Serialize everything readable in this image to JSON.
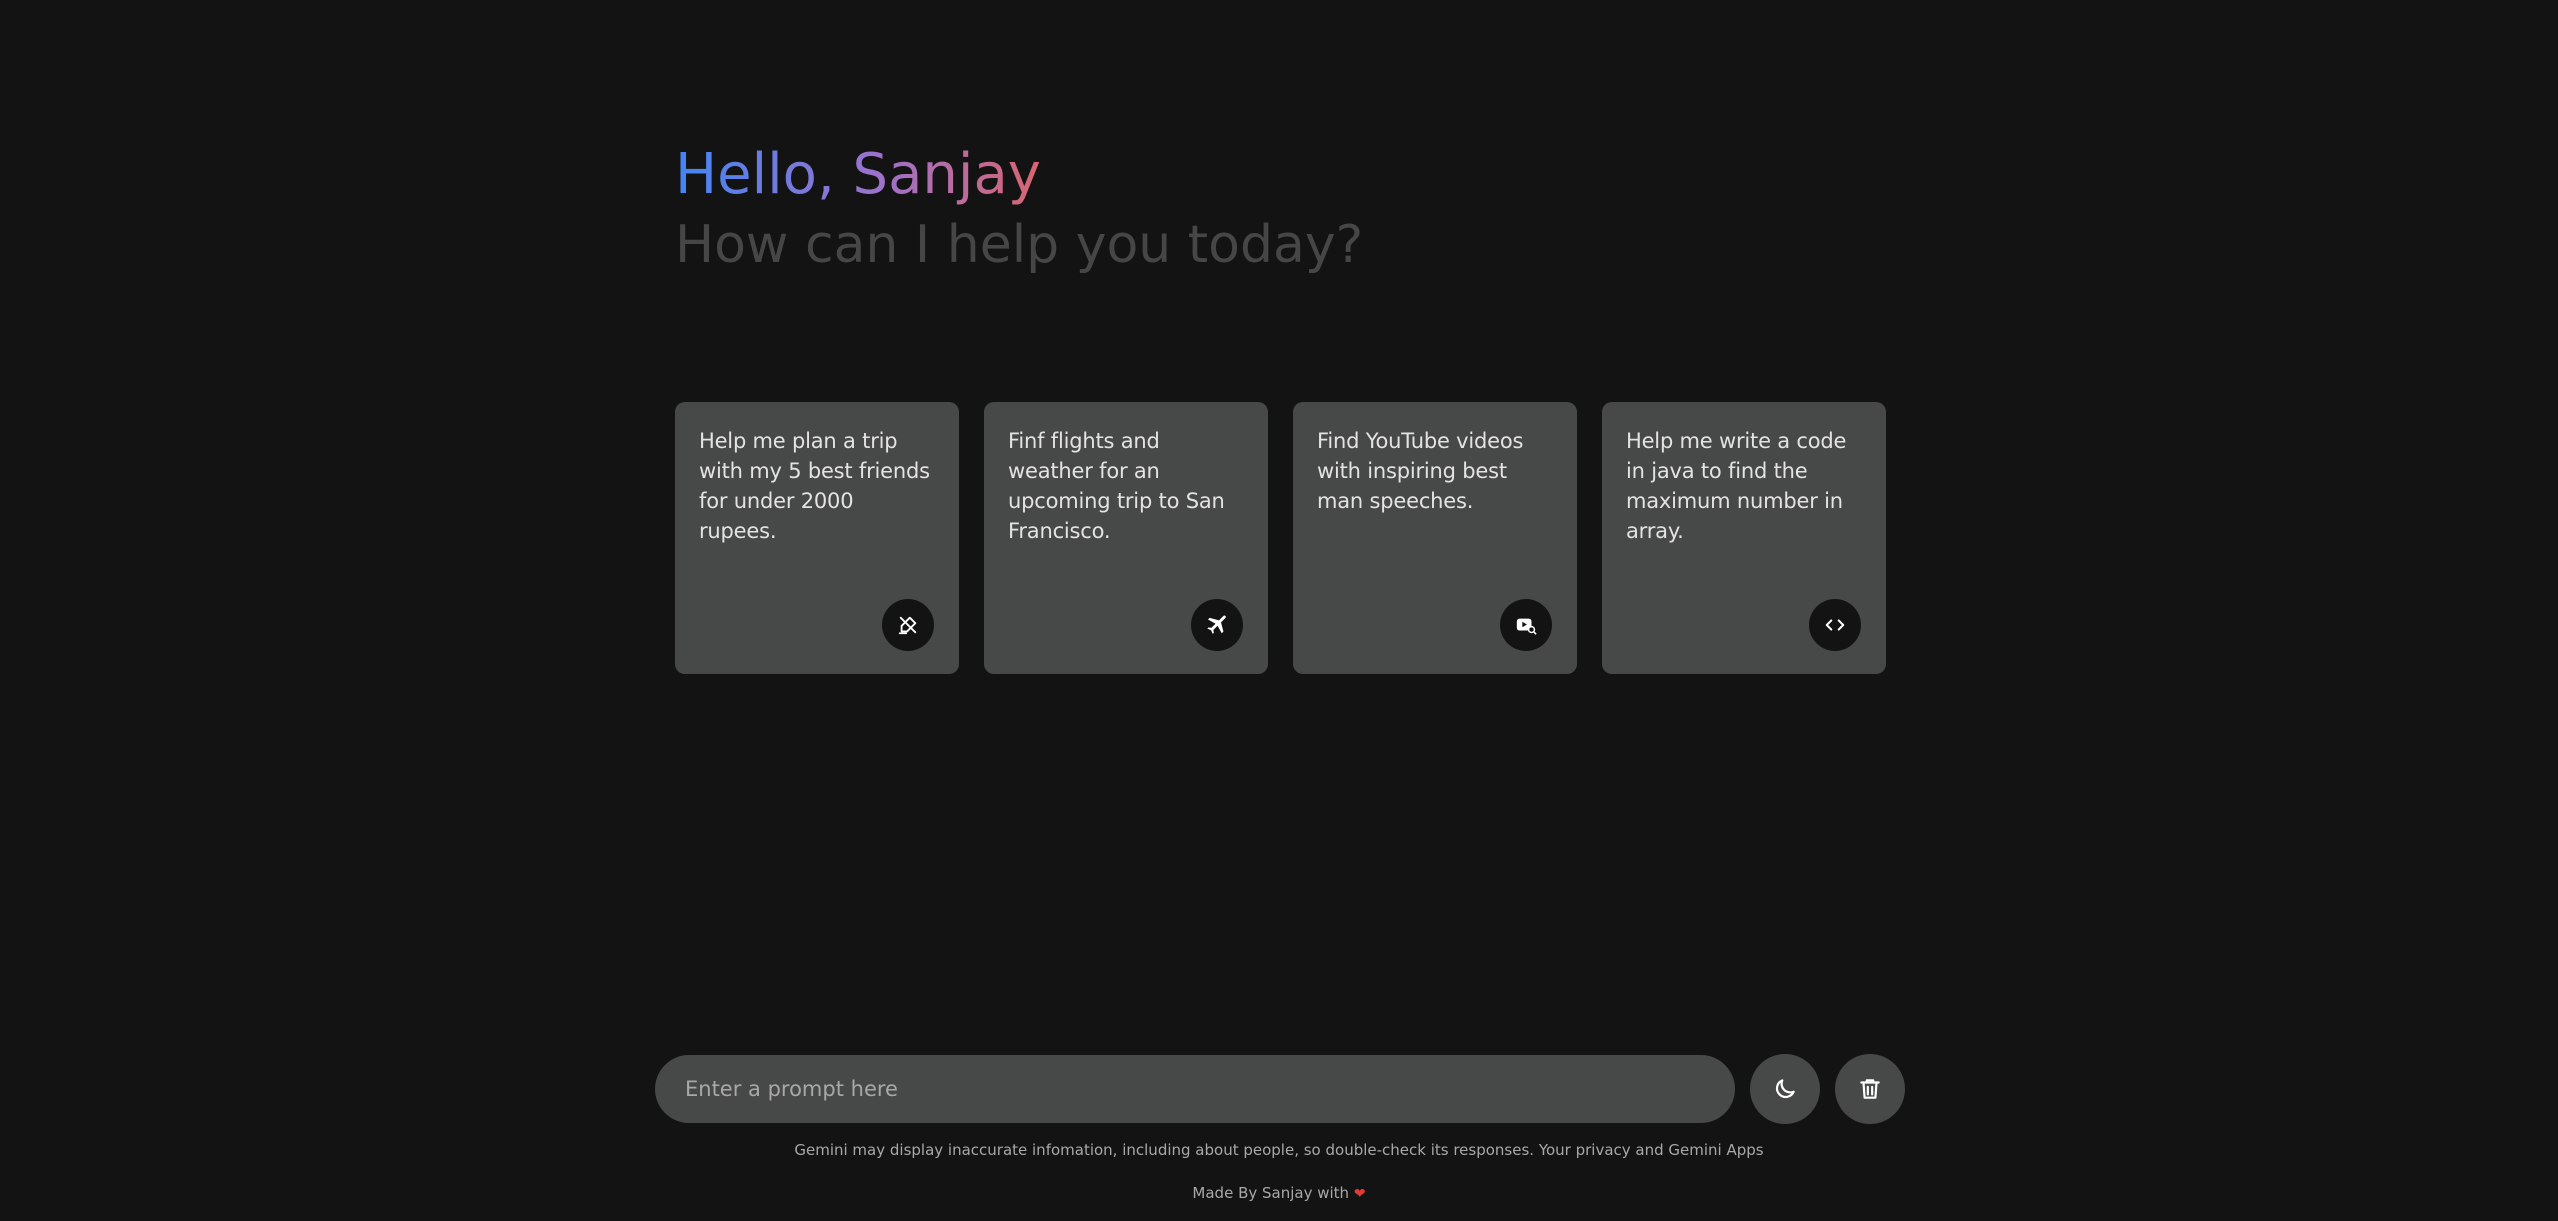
{
  "header": {
    "greeting": "Hello, Sanjay",
    "subtitle": "How can I help you today?"
  },
  "suggestions": [
    {
      "text": "Help me plan a trip with my 5 best friends for under 2000 rupees.",
      "icon": "draw-icon"
    },
    {
      "text": "Finf flights and weather for an upcoming trip to San Francisco.",
      "icon": "flight-icon"
    },
    {
      "text": "Find YouTube videos with inspiring best man speeches.",
      "icon": "video-search-icon"
    },
    {
      "text": "Help me write a code in java to find the maximum number in array.",
      "icon": "code-icon"
    }
  ],
  "prompt": {
    "placeholder": "Enter a prompt here",
    "value": ""
  },
  "footer": {
    "disclaimer": "Gemini may display inaccurate infomation, including about people, so double-check its responses. Your privacy and Gemini Apps",
    "credit": "Made By Sanjay with",
    "heart": "❤"
  },
  "colors": {
    "background": "#131313",
    "card": "#474848",
    "subtitle": "#464646",
    "gradient_start": "#4285f4",
    "gradient_mid": "#9b72cb",
    "gradient_end": "#d96570"
  }
}
